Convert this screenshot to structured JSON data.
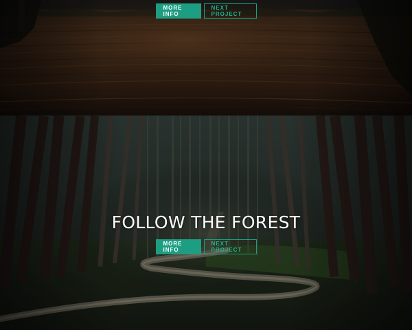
{
  "colors": {
    "accent": "#1d9e82",
    "accent_text": "#1fb592",
    "title_text": "#ffffff"
  },
  "project_field": {
    "more_info_label": "MORE INFO",
    "next_project_label": "NEXT PROJECT"
  },
  "project_forest": {
    "title": "FOLLOW THE FOREST",
    "more_info_label": "MORE INFO",
    "next_project_label": "NEXT PROJECT"
  }
}
